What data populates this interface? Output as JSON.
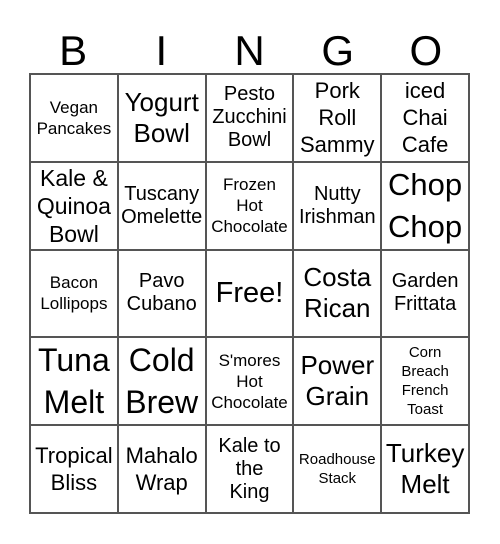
{
  "header": {
    "letters": [
      "B",
      "I",
      "N",
      "G",
      "O"
    ]
  },
  "cells": [
    "Vegan\nPancakes",
    "Yogurt\nBowl",
    "Pesto\nZucchini\nBowl",
    "Pork\nRoll\nSammy",
    "iced\nChai\nCafe",
    "Kale &\nQuinoa\nBowl",
    "Tuscany\nOmelette",
    "Frozen\nHot\nChocolate",
    "Nutty\nIrishman",
    "Chop\nChop",
    "Bacon\nLollipops",
    "Pavo\nCubano",
    "Free!",
    "Costa\nRican",
    "Garden\nFrittata",
    "Tuna\nMelt",
    "Cold\nBrew",
    "S'mores\nHot\nChocolate",
    "Power\nGrain",
    "Corn\nBreach\nFrench\nToast",
    "Tropical\nBliss",
    "Mahalo\nWrap",
    "Kale to\nthe\nKing",
    "Roadhouse\nStack",
    "Turkey\nMelt"
  ]
}
